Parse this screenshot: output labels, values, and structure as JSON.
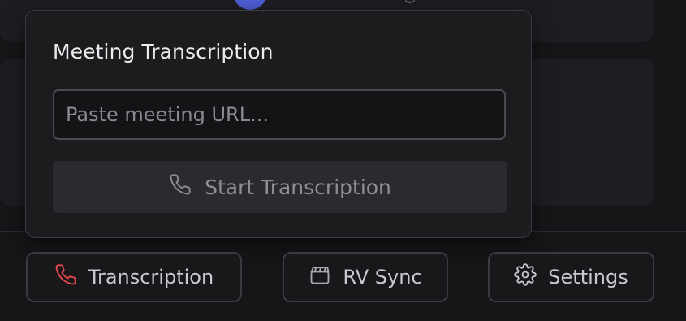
{
  "popover": {
    "title": "Meeting Transcription",
    "url_input": {
      "value": "",
      "placeholder": "Paste meeting URL..."
    },
    "start_button": {
      "label": "Start Transcription",
      "icon": "phone-icon"
    }
  },
  "footer": {
    "transcription": {
      "label": "Transcription",
      "icon": "phone-icon",
      "icon_color": "#e5484d"
    },
    "rv_sync": {
      "label": "RV Sync",
      "icon": "clapperboard-icon"
    },
    "settings": {
      "label": "Settings",
      "icon": "gear-icon"
    }
  },
  "colors": {
    "background": "#161619",
    "popover": "#1c1c1f",
    "accent_red": "#e5484d",
    "avatar": "#4f5fd6"
  }
}
